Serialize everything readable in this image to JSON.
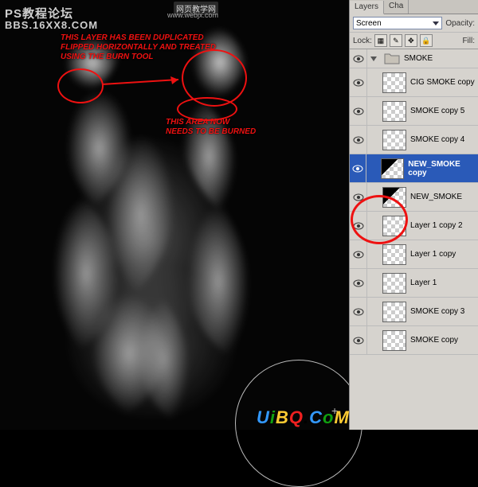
{
  "watermarks": {
    "top_line1": "PS教程论坛",
    "top_line2": "BBS.16XX8.COM",
    "top_right1": "网页教学网",
    "top_right2": "www.webjx.com",
    "bottom_logo": "UiBQ.CoM"
  },
  "annotations": {
    "anno1_l1": "THIS LAYER HAS BEEN DUPLICATED",
    "anno1_l2": "FLIPPED HORIZONTALLY AND TREATED",
    "anno1_l3": "USING THE BURN TOOL",
    "anno2_l1": "THIS AREA NOW",
    "anno2_l2": "NEEDS TO BE BURNED"
  },
  "panel": {
    "tabs": {
      "layers": "Layers",
      "channels": "Cha"
    },
    "blend_mode": "Screen",
    "opacity_label": "Opacity:",
    "lock_label": "Lock:",
    "fill_label": "Fill:",
    "group_name": "SMOKE",
    "layers_list": [
      {
        "name": "CIG SMOKE copy",
        "selected": false
      },
      {
        "name": "SMOKE copy 5",
        "selected": false
      },
      {
        "name": "SMOKE copy 4",
        "selected": false
      },
      {
        "name": "NEW_SMOKE copy",
        "selected": true
      },
      {
        "name": "NEW_SMOKE",
        "selected": false
      },
      {
        "name": "Layer 1 copy 2",
        "selected": false
      },
      {
        "name": "Layer 1 copy",
        "selected": false
      },
      {
        "name": "Layer 1",
        "selected": false
      },
      {
        "name": "SMOKE copy 3",
        "selected": false
      },
      {
        "name": "SMOKE copy",
        "selected": false
      }
    ]
  },
  "colors": {
    "annotation_red": "#e11",
    "selection_blue": "#2a5ab8",
    "panel_bg": "#d6d3ce"
  }
}
